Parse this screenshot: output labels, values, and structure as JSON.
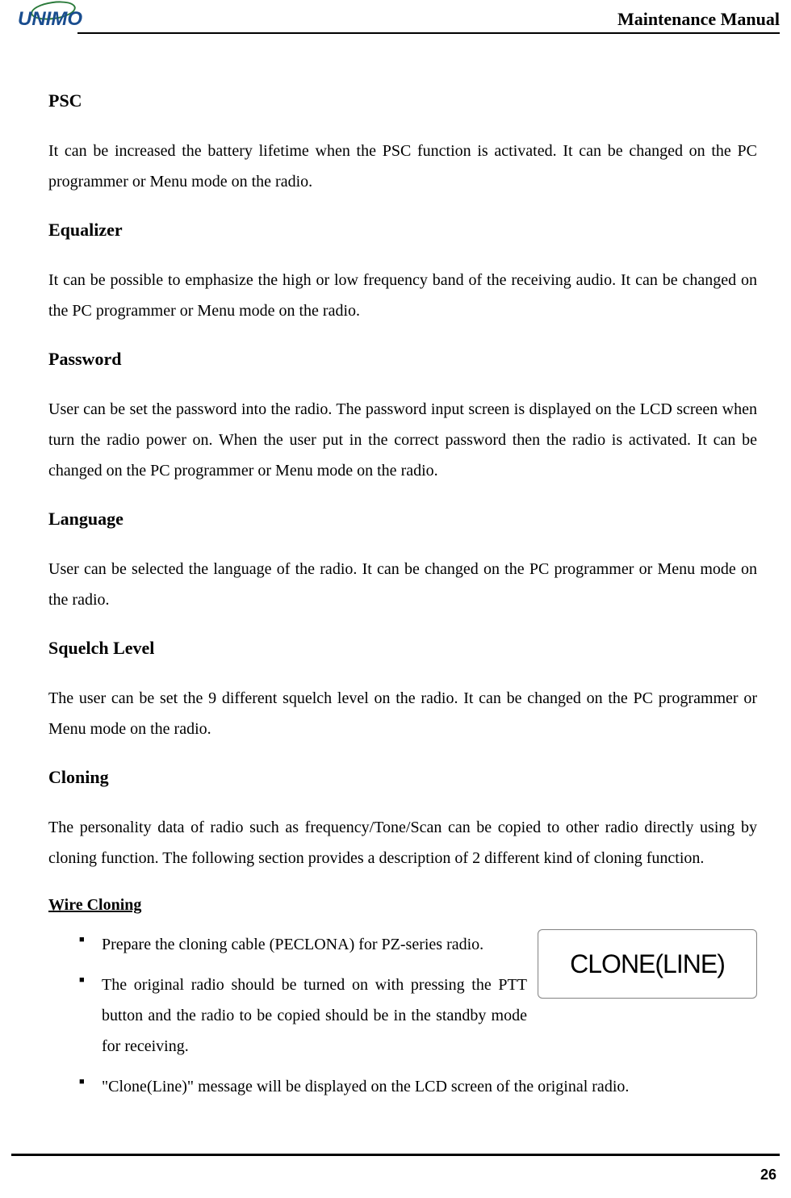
{
  "header": {
    "logo": "UNIMO",
    "title": "Maintenance Manual"
  },
  "sections": {
    "psc": {
      "heading": "PSC",
      "text": "It can be increased the battery lifetime when the PSC function is activated. It can be changed on the PC programmer or Menu mode on the radio."
    },
    "equalizer": {
      "heading": "Equalizer",
      "text": "It can be possible to emphasize the high or low frequency band of the receiving audio. It can be changed on the PC programmer or Menu mode on the radio."
    },
    "password": {
      "heading": "Password",
      "text": "User can be set the password into the radio. The password input screen is displayed on the LCD screen when turn the radio power on. When the user put in the correct password then the radio is activated. It can be changed on the PC programmer or Menu mode on the radio."
    },
    "language": {
      "heading": "Language",
      "text": "User can be selected the language of the radio. It can be changed on the PC programmer or Menu mode on the radio."
    },
    "squelch": {
      "heading": "Squelch Level",
      "text": "The user can be set the 9 different squelch level on the radio. It can be changed on the PC programmer or Menu mode on the radio."
    },
    "cloning": {
      "heading": "Cloning",
      "text": "The personality data of radio such as frequency/Tone/Scan can be copied to other radio directly using by cloning function. The following section provides a description of 2 different kind of cloning function.",
      "subheading": "Wire Cloning",
      "bullets": [
        "Prepare the cloning cable (PECLONA) for PZ-series radio.",
        "The original radio should be turned on with pressing the PTT button and the radio to be copied should be in the standby mode for receiving.",
        "\"Clone(Line)\" message will be displayed on the LCD screen of the original radio."
      ],
      "lcd_display": "CLONE(LINE)"
    }
  },
  "page_number": "26"
}
